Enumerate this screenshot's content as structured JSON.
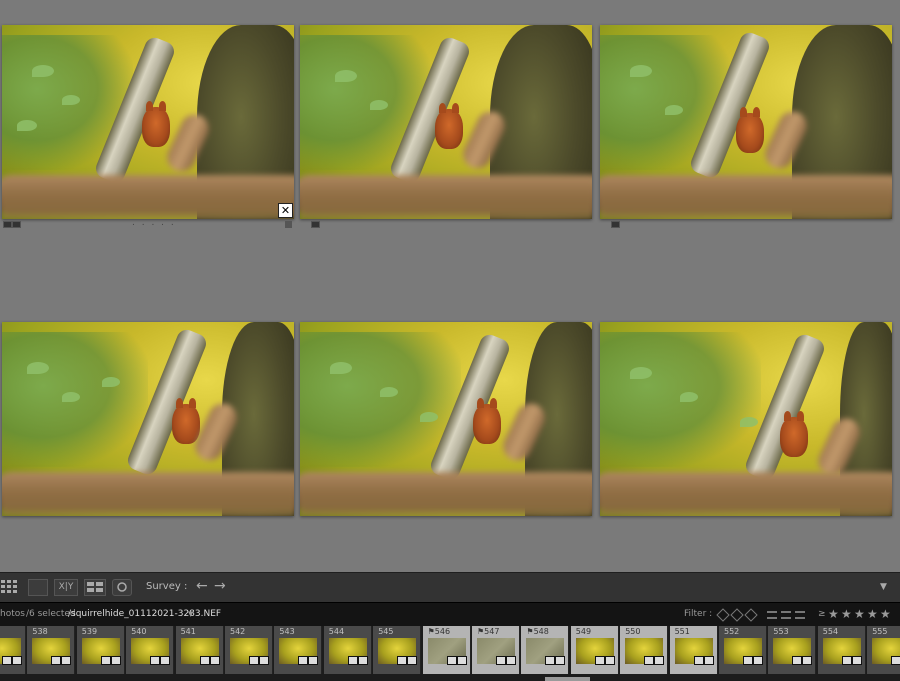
{
  "toolbar": {
    "survey_label": "Survey :",
    "xy_label": "X|Y",
    "back_arrow": "←",
    "forward_arrow": "→",
    "menu_arrow": "▼"
  },
  "filmstrip_header": {
    "photos_text": "hotos",
    "selected_text": "/6 selected",
    "filename": "/squirrelhide_01112021-3283.NEF",
    "filename_menu": "▼",
    "filter_label": "Filter :",
    "rating_prefix": "≥",
    "stars": [
      "★",
      "★",
      "★",
      "★",
      "★"
    ]
  },
  "close_symbol": "✕",
  "thumbnail_dots": ". . . . .",
  "thumbnails": [
    {
      "label": "",
      "selected": false
    },
    {
      "label": "538",
      "selected": false
    },
    {
      "label": "539",
      "selected": false
    },
    {
      "label": "540",
      "selected": false
    },
    {
      "label": "541",
      "selected": false
    },
    {
      "label": "542",
      "selected": false
    },
    {
      "label": "543",
      "selected": false
    },
    {
      "label": "544",
      "selected": false
    },
    {
      "label": "545",
      "selected": false
    },
    {
      "label": "⚑546",
      "selected": true
    },
    {
      "label": "⚑547",
      "selected": true
    },
    {
      "label": "⚑548",
      "selected": true
    },
    {
      "label": "549",
      "selected": true
    },
    {
      "label": "550",
      "selected": true
    },
    {
      "label": "551",
      "selected": true
    },
    {
      "label": "552",
      "selected": false
    },
    {
      "label": "553",
      "selected": false
    },
    {
      "label": "554",
      "selected": false
    },
    {
      "label": "555",
      "selected": false
    }
  ],
  "colors": {
    "background": "#7a7a7a",
    "toolbar": "#333333",
    "filmstrip": "#1c1c1c",
    "selected_thumb": "#b4b4b4"
  },
  "icons": [
    "grid-view-icon",
    "loupe-view-icon",
    "compare-view-icon",
    "survey-view-icon",
    "people-view-icon",
    "filter-flag-icon",
    "filter-color-icon",
    "star-icon"
  ]
}
